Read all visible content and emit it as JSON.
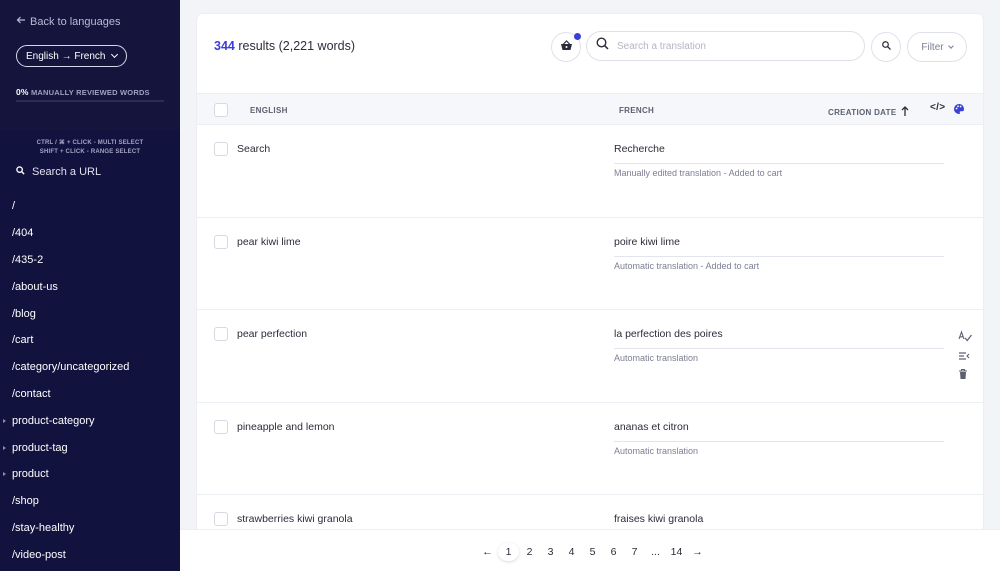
{
  "sidebar": {
    "back_label": "Back to languages",
    "language_pair": "English → French",
    "review_percent": "0%",
    "review_label": "MANUALLY REVIEWED WORDS",
    "hint_multi": "CTRL / ⌘ + CLICK - MULTI SELECT",
    "hint_range": "SHIFT + CLICK - RANGE SELECT",
    "search_url_label": "Search a URL",
    "urls": [
      {
        "label": "/",
        "expandable": false
      },
      {
        "label": "/404",
        "expandable": false
      },
      {
        "label": "/435-2",
        "expandable": false
      },
      {
        "label": "/about-us",
        "expandable": false
      },
      {
        "label": "/blog",
        "expandable": false
      },
      {
        "label": "/cart",
        "expandable": false
      },
      {
        "label": "/category/uncategorized",
        "expandable": false
      },
      {
        "label": "/contact",
        "expandable": false
      },
      {
        "label": "product-category",
        "expandable": true
      },
      {
        "label": "product-tag",
        "expandable": true
      },
      {
        "label": "product",
        "expandable": true
      },
      {
        "label": "/shop",
        "expandable": false
      },
      {
        "label": "/stay-healthy",
        "expandable": false
      },
      {
        "label": "/video-post",
        "expandable": false
      }
    ]
  },
  "toolbar": {
    "results_count": "344",
    "results_suffix": " results (2,221 words)",
    "search_placeholder": "Search a translation",
    "filter_label": "Filter"
  },
  "table": {
    "col_source": "ENGLISH",
    "col_target": "FRENCH",
    "col_date": "CREATION DATE",
    "code_toggle": "</>",
    "rows": [
      {
        "source": "Search",
        "target": "Recherche",
        "status": "Manually edited translation - Added to cart",
        "show_actions": false
      },
      {
        "source": "pear kiwi lime",
        "target": "poire kiwi lime",
        "status": "Automatic translation - Added to cart",
        "show_actions": false
      },
      {
        "source": "pear perfection",
        "target": "la perfection des poires",
        "status": "Automatic translation",
        "show_actions": true
      },
      {
        "source": "pineapple and lemon",
        "target": "ananas et citron",
        "status": "Automatic translation",
        "show_actions": false
      },
      {
        "source": "strawberries kiwi granola",
        "target": "fraises kiwi granola",
        "status": "",
        "show_actions": false
      }
    ]
  },
  "pagination": {
    "prev": "←",
    "next": "→",
    "pages": [
      "1",
      "2",
      "3",
      "4",
      "5",
      "6",
      "7",
      "...",
      "14"
    ],
    "current": "1"
  },
  "colors": {
    "sidebar_bg": "#12123f",
    "accent": "#3a3fd9"
  },
  "icons": {
    "back": "arrow-left-icon",
    "cart": "basket-icon",
    "search": "search-icon",
    "search_replace": "search-replace-icon",
    "sort": "arrow-up-icon",
    "palette": "palette-icon",
    "spellcheck": "spellcheck-icon",
    "details": "list-detail-icon",
    "delete": "trash-icon"
  }
}
